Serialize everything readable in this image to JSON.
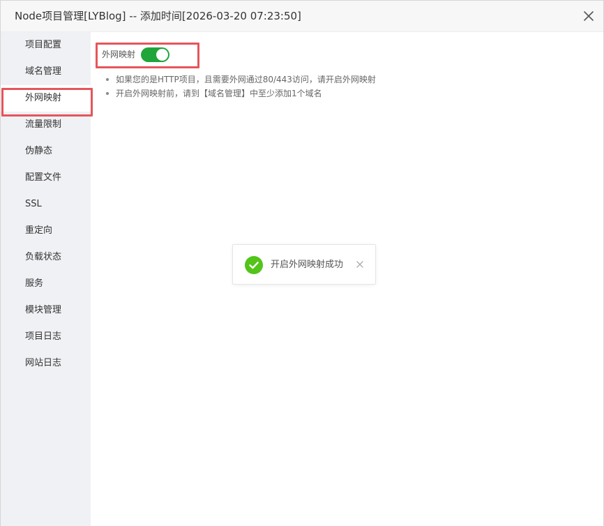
{
  "window": {
    "title": "Node项目管理[LYBlog] -- 添加时间[2026-03-20 07:23:50]",
    "close_icon": "close-icon"
  },
  "sidebar": {
    "items": [
      {
        "label": "项目配置"
      },
      {
        "label": "域名管理"
      },
      {
        "label": "外网映射",
        "active": true
      },
      {
        "label": "流量限制"
      },
      {
        "label": "伪静态"
      },
      {
        "label": "配置文件"
      },
      {
        "label": "SSL"
      },
      {
        "label": "重定向"
      },
      {
        "label": "负载状态"
      },
      {
        "label": "服务"
      },
      {
        "label": "模块管理"
      },
      {
        "label": "项目日志"
      },
      {
        "label": "网站日志"
      }
    ]
  },
  "main": {
    "toggle": {
      "label": "外网映射",
      "on": true,
      "color": "#20a53a"
    },
    "tips": [
      "如果您的是HTTP项目，且需要外网通过80/443访问，请开启外网映射",
      "开启外网映射前，请到【域名管理】中至少添加1个域名"
    ]
  },
  "toast": {
    "message": "开启外网映射成功",
    "icon": "check-circle-icon",
    "icon_color": "#52c41a",
    "close_icon": "close-icon"
  },
  "highlight_color": "#e5555b"
}
